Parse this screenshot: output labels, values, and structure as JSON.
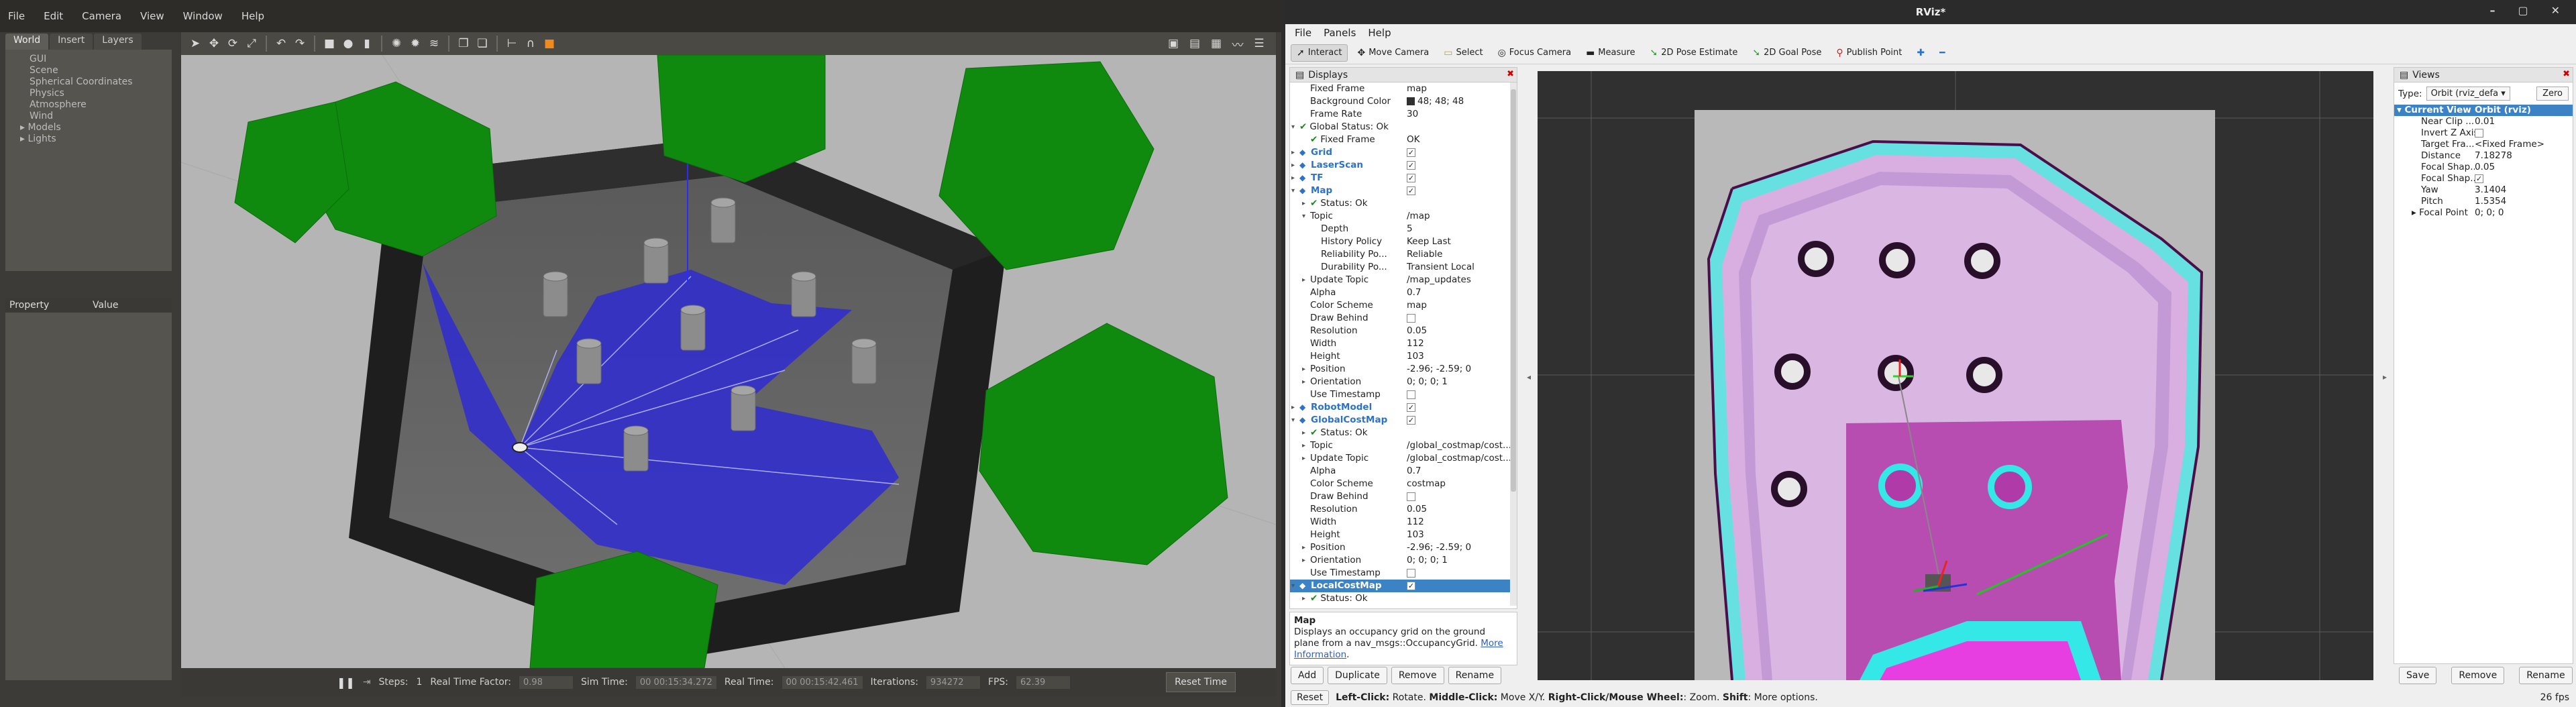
{
  "gazebo": {
    "menu": [
      "File",
      "Edit",
      "Camera",
      "View",
      "Window",
      "Help"
    ],
    "tabs": [
      "World",
      "Insert",
      "Layers"
    ],
    "tree": [
      "GUI",
      "Scene",
      "Spherical Coordinates",
      "Physics",
      "Atmosphere",
      "Wind",
      "Models",
      "Lights"
    ],
    "prop_header": {
      "property": "Property",
      "value": "Value"
    },
    "bottom": {
      "steps_label": "Steps:",
      "steps_value": "1",
      "rtf_label": "Real Time Factor:",
      "rtf_value": "0.98",
      "sim_label": "Sim Time:",
      "sim_value": "00 00:15:34.272",
      "real_label": "Real Time:",
      "real_value": "00 00:15:42.461",
      "iter_label": "Iterations:",
      "iter_value": "934272",
      "fps_label": "FPS:",
      "fps_value": "62.39",
      "reset": "Reset Time"
    }
  },
  "rviz": {
    "title": "RViz*",
    "menu": [
      "File",
      "Panels",
      "Help"
    ],
    "tools": [
      {
        "label": "Interact",
        "icon": "interact-icon",
        "active": true
      },
      {
        "label": "Move Camera",
        "icon": "move-camera-icon"
      },
      {
        "label": "Select",
        "icon": "select-icon"
      },
      {
        "label": "Focus Camera",
        "icon": "focus-camera-icon"
      },
      {
        "label": "Measure",
        "icon": "measure-icon"
      },
      {
        "label": "2D Pose Estimate",
        "icon": "pose-estimate-icon"
      },
      {
        "label": "2D Goal Pose",
        "icon": "goal-pose-icon"
      },
      {
        "label": "Publish Point",
        "icon": "publish-point-icon"
      }
    ],
    "displays_title": "Displays",
    "displays": [
      {
        "k": "Fixed Frame",
        "v": "map",
        "ind": 1
      },
      {
        "k": "Background Color",
        "v": "48; 48; 48",
        "ind": 1,
        "swatch": "#303030"
      },
      {
        "k": "Frame Rate",
        "v": "30",
        "ind": 1
      },
      {
        "k": "Global Status: Ok",
        "v": "",
        "ind": 0,
        "arrow": "▾",
        "ok": true
      },
      {
        "k": "Fixed Frame",
        "v": "OK",
        "ind": 1,
        "ok": true
      },
      {
        "k": "Grid",
        "v": "",
        "ind": 0,
        "arrow": "▸",
        "disp": true,
        "cb": true
      },
      {
        "k": "LaserScan",
        "v": "",
        "ind": 0,
        "arrow": "▸",
        "disp": true,
        "cb": true
      },
      {
        "k": "TF",
        "v": "",
        "ind": 0,
        "arrow": "▸",
        "disp": true,
        "cb": true
      },
      {
        "k": "Map",
        "v": "",
        "ind": 0,
        "arrow": "▾",
        "disp": true,
        "cb": true
      },
      {
        "k": "Status: Ok",
        "v": "",
        "ind": 1,
        "arrow": "▸",
        "ok": true
      },
      {
        "k": "Topic",
        "v": "/map",
        "ind": 1,
        "arrow": "▾"
      },
      {
        "k": "Depth",
        "v": "5",
        "ind": 2
      },
      {
        "k": "History Policy",
        "v": "Keep Last",
        "ind": 2
      },
      {
        "k": "Reliability Po...",
        "v": "Reliable",
        "ind": 2
      },
      {
        "k": "Durability Po...",
        "v": "Transient Local",
        "ind": 2
      },
      {
        "k": "Update Topic",
        "v": "/map_updates",
        "ind": 1,
        "arrow": "▸"
      },
      {
        "k": "Alpha",
        "v": "0.7",
        "ind": 1
      },
      {
        "k": "Color Scheme",
        "v": "map",
        "ind": 1
      },
      {
        "k": "Draw Behind",
        "v": "",
        "ind": 1,
        "cb": false
      },
      {
        "k": "Resolution",
        "v": "0.05",
        "ind": 1
      },
      {
        "k": "Width",
        "v": "112",
        "ind": 1
      },
      {
        "k": "Height",
        "v": "103",
        "ind": 1
      },
      {
        "k": "Position",
        "v": "-2.96; -2.59; 0",
        "ind": 1,
        "arrow": "▸"
      },
      {
        "k": "Orientation",
        "v": "0; 0; 0; 1",
        "ind": 1,
        "arrow": "▸"
      },
      {
        "k": "Use Timestamp",
        "v": "",
        "ind": 1,
        "cb": false
      },
      {
        "k": "RobotModel",
        "v": "",
        "ind": 0,
        "arrow": "▸",
        "disp": true,
        "cb": true
      },
      {
        "k": "GlobalCostMap",
        "v": "",
        "ind": 0,
        "arrow": "▾",
        "disp": true,
        "cb": true
      },
      {
        "k": "Status: Ok",
        "v": "",
        "ind": 1,
        "arrow": "▸",
        "ok": true
      },
      {
        "k": "Topic",
        "v": "/global_costmap/cost...",
        "ind": 1,
        "arrow": "▸"
      },
      {
        "k": "Update Topic",
        "v": "/global_costmap/cost...",
        "ind": 1,
        "arrow": "▸"
      },
      {
        "k": "Alpha",
        "v": "0.7",
        "ind": 1
      },
      {
        "k": "Color Scheme",
        "v": "costmap",
        "ind": 1
      },
      {
        "k": "Draw Behind",
        "v": "",
        "ind": 1,
        "cb": false
      },
      {
        "k": "Resolution",
        "v": "0.05",
        "ind": 1
      },
      {
        "k": "Width",
        "v": "112",
        "ind": 1
      },
      {
        "k": "Height",
        "v": "103",
        "ind": 1
      },
      {
        "k": "Position",
        "v": "-2.96; -2.59; 0",
        "ind": 1,
        "arrow": "▸"
      },
      {
        "k": "Orientation",
        "v": "0; 0; 0; 1",
        "ind": 1,
        "arrow": "▸"
      },
      {
        "k": "Use Timestamp",
        "v": "",
        "ind": 1,
        "cb": false
      },
      {
        "k": "LocalCostMap",
        "v": "",
        "ind": 0,
        "arrow": "▾",
        "disp": true,
        "cb": true,
        "sel": true
      },
      {
        "k": "Status: Ok",
        "v": "",
        "ind": 1,
        "arrow": "▸",
        "ok": true
      }
    ],
    "desc": {
      "title": "Map",
      "text": "Displays an occupancy grid on the ground plane from a nav_msgs::OccupancyGrid.",
      "link1": "More",
      "link2": "Information"
    },
    "display_buttons": [
      "Add",
      "Duplicate",
      "Remove",
      "Rename"
    ],
    "views_title": "Views",
    "views_type_label": "Type:",
    "views_type_value": "Orbit (rviz_defa",
    "views_zero": "Zero",
    "views_head": {
      "k": "Current View",
      "v": "Orbit (rviz)"
    },
    "views": [
      {
        "k": "Near Clip ...",
        "v": "0.01"
      },
      {
        "k": "Invert Z Axis",
        "v": "",
        "cb": false
      },
      {
        "k": "Target Fra...",
        "v": "<Fixed Frame>"
      },
      {
        "k": "Distance",
        "v": "7.18278"
      },
      {
        "k": "Focal Shap...",
        "v": "0.05"
      },
      {
        "k": "Focal Shap...",
        "v": "",
        "cb": true
      },
      {
        "k": "Yaw",
        "v": "3.1404"
      },
      {
        "k": "Pitch",
        "v": "1.5354"
      },
      {
        "k": "Focal Point",
        "v": "0; 0; 0",
        "arrow": "▸"
      }
    ],
    "views_buttons": [
      "Save",
      "Remove",
      "Rename"
    ],
    "status": {
      "reset": "Reset",
      "help_b1": "Left-Click:",
      "help_t1": " Rotate. ",
      "help_b2": "Middle-Click:",
      "help_t2": " Move X/Y. ",
      "help_b3": "Right-Click/Mouse Wheel:",
      "help_t3": ": Zoom. ",
      "help_b4": "Shift",
      "help_t4": ": More options.",
      "fps": "26 fps"
    }
  }
}
